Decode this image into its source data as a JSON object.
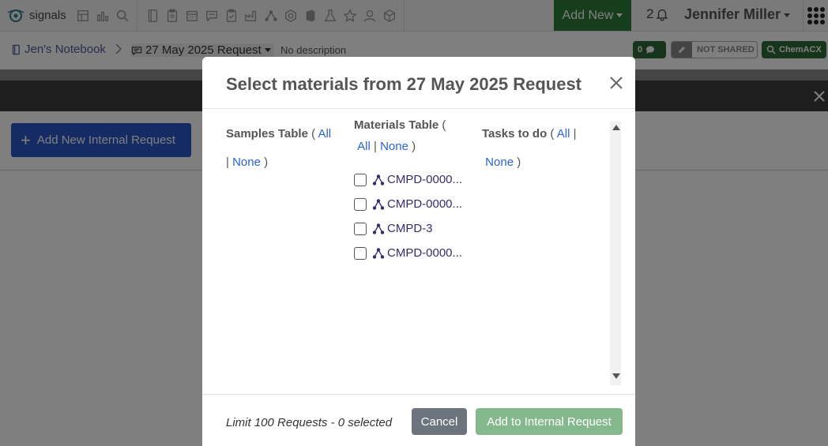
{
  "app": {
    "name": "signals"
  },
  "topnav": {
    "icons": [
      "dashboard-icon",
      "chart-icon",
      "search-icon",
      "notebook-icon",
      "clipboard-icon",
      "calendar-icon",
      "chat-icon",
      "clipboard-check-icon",
      "factory-icon",
      "molecule-icon",
      "hexagon-icon",
      "office-icon",
      "flask-icon",
      "star-icon",
      "users-icon",
      "cube-icon"
    ],
    "add_new_label": "Add New",
    "notification_count": "2",
    "user_name": "Jennifer Miller"
  },
  "breadcrumb": {
    "notebook": "Jen's Notebook",
    "request": "27 May 2025 Request",
    "description": "No description"
  },
  "status": {
    "comment_count": "0",
    "share_label": "NOT SHARED",
    "chemacx_label": "ChemACX"
  },
  "page": {
    "add_request_label": "Add New Internal Request"
  },
  "modal": {
    "title": "Select materials from 27 May 2025 Request",
    "columns": {
      "samples": {
        "label": "Samples Table",
        "all": "All",
        "none": "None"
      },
      "materials": {
        "label": "Materials Table",
        "all": "All",
        "none": "None"
      },
      "tasks": {
        "label": "Tasks to do",
        "all": "All",
        "none": "None"
      }
    },
    "materials": [
      {
        "name": "CMPD-0000..."
      },
      {
        "name": "CMPD-0000..."
      },
      {
        "name": "CMPD-3"
      },
      {
        "name": "CMPD-0000..."
      }
    ],
    "limit_text": "Limit 100 Requests - 0 selected",
    "cancel_label": "Cancel",
    "add_label": "Add to Internal Request"
  },
  "colors": {
    "accent_green": "#2d7d3a",
    "primary_blue": "#2b57c8",
    "link_blue": "#2b63d6",
    "disabled_green": "#86b88e"
  }
}
